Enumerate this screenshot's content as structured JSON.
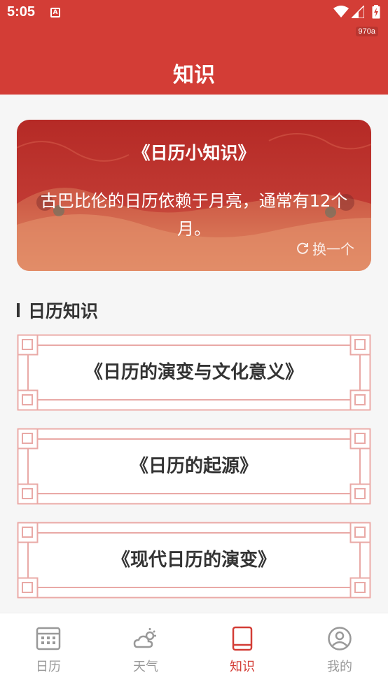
{
  "status_bar": {
    "time": "5:05",
    "notification_glyph": "A",
    "build_tag": "970a"
  },
  "header": {
    "title": "知识"
  },
  "tip_card": {
    "title": "《日历小知识》",
    "text": "古巴比伦的日历依赖于月亮，通常有12个月。",
    "refresh_label": "换一个"
  },
  "section": {
    "title": "日历知识"
  },
  "articles": [
    {
      "title": "《日历的演变与文化意义》"
    },
    {
      "title": "《日历的起源》"
    },
    {
      "title": "《现代日历的演变》"
    }
  ],
  "tabbar": {
    "tabs": [
      {
        "label": "日历",
        "icon": "calendar-grid-icon",
        "active": false
      },
      {
        "label": "天气",
        "icon": "weather-icon",
        "active": false
      },
      {
        "label": "知识",
        "icon": "book-icon",
        "active": true
      },
      {
        "label": "我的",
        "icon": "profile-icon",
        "active": false
      }
    ]
  },
  "colors": {
    "brand": "#d33d36",
    "text": "#333333",
    "muted": "#999999",
    "frame": "#e9a9a6"
  }
}
